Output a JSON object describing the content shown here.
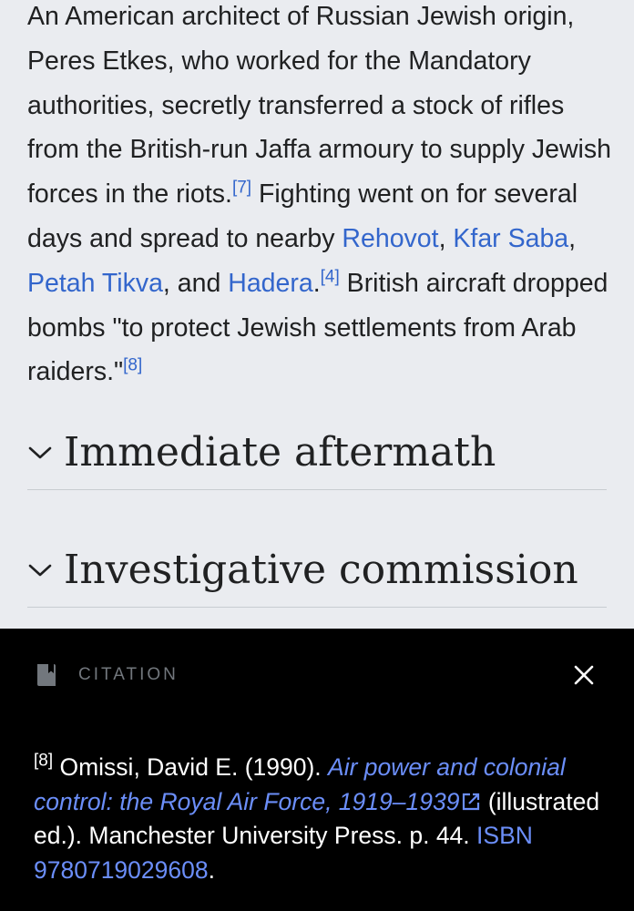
{
  "article": {
    "paragraph": {
      "t1": "An American architect of Russian Jewish origin, Peres Etkes, who worked for the Mandatory authorities, secretly transferred a stock of rifles from the British-run Jaffa armoury to supply Jewish forces in the riots.",
      "ref7": "[7]",
      "t2": " Fighting went on for several days and spread to nearby ",
      "rehovot": "Rehovot",
      "sep1": ", ",
      "kfar_saba": "Kfar Saba",
      "sep2": ", ",
      "petah_tikva": "Petah Tikva",
      "sep3": ", and ",
      "hadera": "Hadera",
      "sep4": ".",
      "ref4": "[4]",
      "t3": " British aircraft dropped bombs \"to protect Jewish settlements from Arab raiders.\"",
      "ref8": "[8]"
    },
    "sections": [
      {
        "title": "Immediate aftermath"
      },
      {
        "title": "Investigative commission"
      }
    ]
  },
  "drawer": {
    "header": "CITATION",
    "icon": "book-bookmark-icon",
    "close_icon": "close-icon",
    "citation": {
      "ref": "[8]",
      "text1": " Omissi, David E. (1990). ",
      "title": "Air power and colonial control: the Royal Air Force, 1919–1939",
      "text2": " (illustrated ed.). Manchester University Press. p. 44. ",
      "isbn": "ISBN 9780719029608",
      "end": "."
    }
  },
  "colors": {
    "page_bg": "#eaecf0",
    "text": "#202122",
    "link": "#3366cc",
    "drawer_bg": "#000000",
    "drawer_link": "#6b8ef9",
    "divider": "#c8ccd1"
  }
}
